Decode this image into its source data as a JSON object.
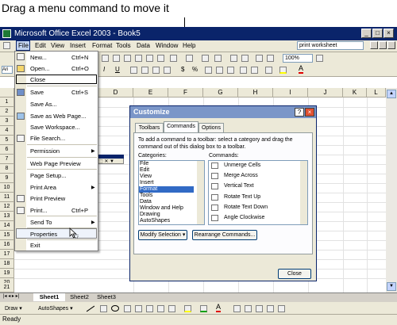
{
  "caption": "Drag a menu command to move it",
  "app": {
    "title": "Microsoft Office Excel 2003 - Book5"
  },
  "menubar": [
    "File",
    "Edit",
    "View",
    "Insert",
    "Format",
    "Tools",
    "Data",
    "Window",
    "Help"
  ],
  "ask_box": "print worksheet",
  "zoom": "100%",
  "name_box": "Ari",
  "columns": [
    "D",
    "E",
    "F",
    "G",
    "H",
    "I",
    "J",
    "K",
    "L"
  ],
  "rows": [
    "1",
    "2",
    "3",
    "4",
    "5",
    "6",
    "7",
    "8",
    "9",
    "10",
    "11",
    "12",
    "13",
    "14",
    "15",
    "16",
    "17",
    "18",
    "19",
    "20",
    "21"
  ],
  "file_menu": [
    {
      "label": "New...",
      "key": "Ctrl+N",
      "icon": "new-icon"
    },
    {
      "label": "Open...",
      "key": "Ctrl+O",
      "icon": "open-icon"
    },
    {
      "label": "Close",
      "key": "",
      "icon": ""
    },
    {
      "label": "Save",
      "key": "Ctrl+S",
      "icon": "save-icon"
    },
    {
      "label": "Save As...",
      "key": "",
      "icon": ""
    },
    {
      "label": "Save as Web Page...",
      "key": "",
      "icon": "web-page-icon"
    },
    {
      "label": "Save Workspace...",
      "key": "",
      "icon": ""
    },
    {
      "label": "File Search...",
      "key": "",
      "icon": "file-search-icon"
    },
    {
      "label": "Permission",
      "key": "",
      "icon": ""
    },
    {
      "label": "Web Page Preview",
      "key": "",
      "icon": ""
    },
    {
      "label": "Page Setup...",
      "key": "",
      "icon": ""
    },
    {
      "label": "Print Area",
      "key": "",
      "icon": ""
    },
    {
      "label": "Print Preview",
      "key": "",
      "icon": "print-preview-icon"
    },
    {
      "label": "Print...",
      "key": "Ctrl+P",
      "icon": "print-icon"
    },
    {
      "label": "Send To",
      "key": "",
      "icon": ""
    },
    {
      "label": "Properties",
      "key": "",
      "icon": ""
    },
    {
      "label": "Exit",
      "key": "",
      "icon": ""
    }
  ],
  "customize": {
    "title": "Customize",
    "tabs": [
      "Toolbars",
      "Commands",
      "Options"
    ],
    "instructions_line1": "To add a command to a toolbar: select a category and drag the",
    "instructions_line2": "command out of this dialog box to a toolbar.",
    "categories_label": "Categories:",
    "commands_label": "Commands:",
    "categories": [
      "File",
      "Edit",
      "View",
      "Insert",
      "Format",
      "Tools",
      "Data",
      "Window and Help",
      "Drawing",
      "AutoShapes"
    ],
    "selected_category": "Format",
    "commands": [
      "Unmerge Cells",
      "Merge Across",
      "Vertical Text",
      "Rotate Text Up",
      "Rotate Text Down",
      "Angle Clockwise"
    ],
    "modify_selection": "Modify Selection ▾",
    "rearrange": "Rearrange Commands...",
    "close": "Close"
  },
  "sheet_tabs": [
    "Sheet1",
    "Sheet2",
    "Sheet3"
  ],
  "drawing": {
    "draw": "Draw ▾",
    "autoshapes": "AutoShapes ▾"
  },
  "status": "Ready",
  "colors": {
    "titlebar": "#0a246a",
    "dialog_title": "#7b96c8",
    "selection": "#316ac5"
  }
}
